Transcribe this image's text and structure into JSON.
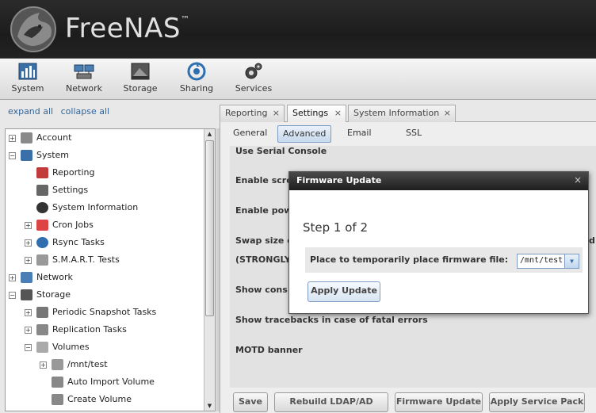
{
  "app": {
    "logo_text": "FreeNAS",
    "logo_tm": "™"
  },
  "toolbar": {
    "items": [
      {
        "label": "System",
        "icon": "system-icon"
      },
      {
        "label": "Network",
        "icon": "network-icon"
      },
      {
        "label": "Storage",
        "icon": "storage-icon"
      },
      {
        "label": "Sharing",
        "icon": "sharing-icon"
      },
      {
        "label": "Services",
        "icon": "services-icon"
      }
    ]
  },
  "tree_controls": {
    "expand_all": "expand all",
    "collapse_all": "collapse all"
  },
  "tree": {
    "items": [
      {
        "label": "Account",
        "toggle": "+",
        "icon": "account-icon"
      },
      {
        "label": "System",
        "toggle": "−",
        "icon": "system-icon"
      },
      {
        "label": "Reporting",
        "icon": "reporting-icon"
      },
      {
        "label": "Settings",
        "icon": "wrench-icon"
      },
      {
        "label": "System Information",
        "icon": "info-icon"
      },
      {
        "label": "Cron Jobs",
        "toggle": "+",
        "icon": "calendar-icon"
      },
      {
        "label": "Rsync Tasks",
        "toggle": "+",
        "icon": "sync-icon"
      },
      {
        "label": "S.M.A.R.T. Tests",
        "toggle": "+",
        "icon": "smart-icon"
      },
      {
        "label": "Network",
        "toggle": "+",
        "icon": "network-icon"
      },
      {
        "label": "Storage",
        "toggle": "−",
        "icon": "storage-icon"
      },
      {
        "label": "Periodic Snapshot Tasks",
        "toggle": "+",
        "icon": "snapshot-icon"
      },
      {
        "label": "Replication Tasks",
        "toggle": "+",
        "icon": "replication-icon"
      },
      {
        "label": "Volumes",
        "toggle": "−",
        "icon": "volumes-icon"
      },
      {
        "label": "/mnt/test",
        "toggle": "+",
        "icon": "disk-icon"
      },
      {
        "label": "Auto Import Volume",
        "icon": "import-icon"
      },
      {
        "label": "Create Volume",
        "icon": "create-icon"
      }
    ]
  },
  "tabs": [
    {
      "label": "Reporting",
      "close": "×"
    },
    {
      "label": "Settings",
      "close": "×",
      "active": true
    },
    {
      "label": "System Information",
      "close": "×"
    }
  ],
  "subtabs": [
    {
      "label": "General"
    },
    {
      "label": "Advanced",
      "active": true
    },
    {
      "label": "Email"
    },
    {
      "label": "SSL"
    }
  ],
  "form": {
    "rows": [
      "Use Serial Console",
      "Enable scre",
      "Enable pow",
      "Swap size o",
      "(STRONGLY",
      "Show cons",
      "Show tracebacks in case of fatal errors",
      "MOTD banner"
    ],
    "right_edge_char": "d"
  },
  "bottom_buttons": [
    "Save",
    "Rebuild LDAP/AD Cache",
    "Firmware Update",
    "Apply Service Pack"
  ],
  "dialog": {
    "title": "Firmware Update",
    "close": "×",
    "step": "Step 1 of 2",
    "field_label": "Place to temporarily place firmware file:",
    "select_value": "/mnt/test",
    "apply_label": "Apply Update"
  },
  "colors": {
    "header": "#222222",
    "accent": "#7c9cc2",
    "link": "#336699"
  }
}
